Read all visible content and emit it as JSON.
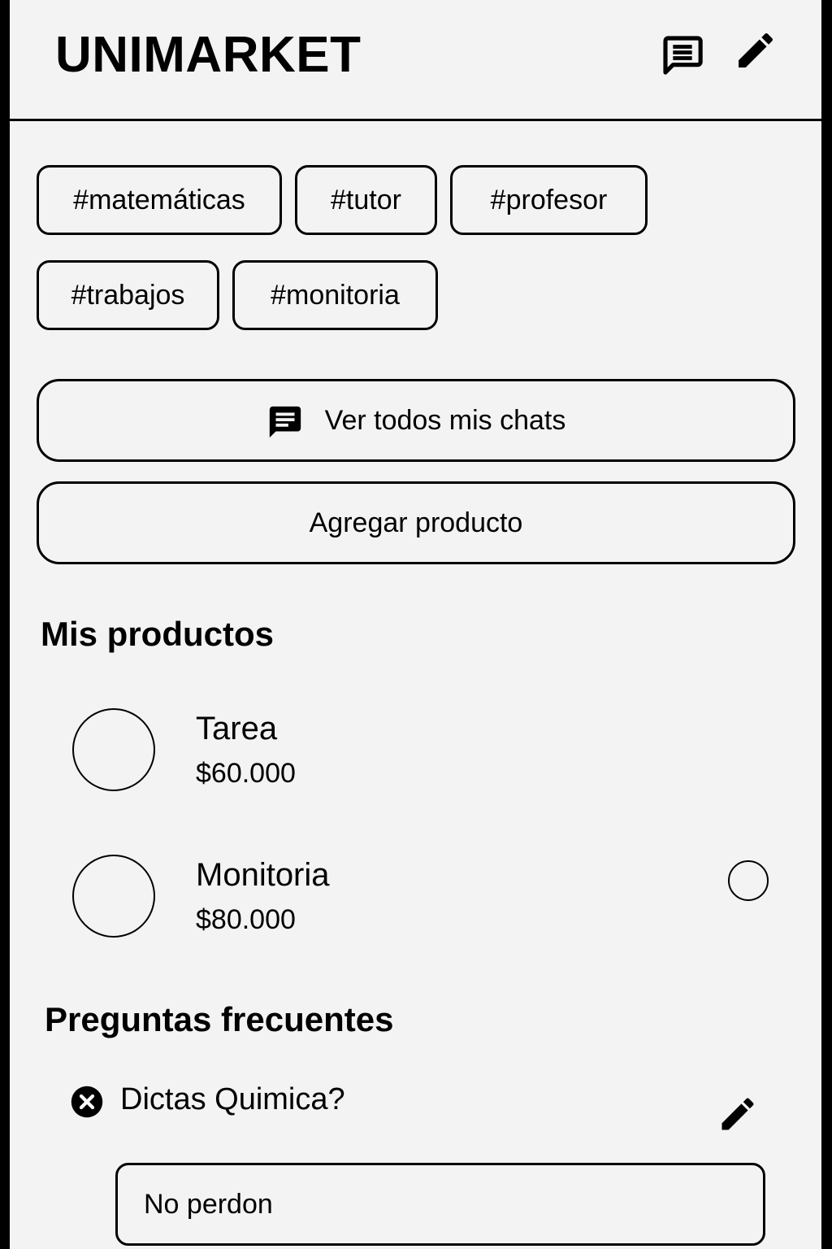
{
  "header": {
    "title": "UNIMARKET",
    "icons": [
      "chat-icon",
      "edit-icon"
    ]
  },
  "tags": [
    "#matemáticas",
    "#tutor",
    "#profesor",
    "#trabajos",
    "#monitoria"
  ],
  "buttons": {
    "view_chats": "Ver todos mis chats",
    "view_chats_icon": "chat-icon",
    "add_product": "Agregar producto"
  },
  "products": {
    "title": "Mis productos",
    "items": [
      {
        "name": "Tarea",
        "price": "$60.000"
      },
      {
        "name": "Monitoria",
        "price": "$80.000"
      }
    ]
  },
  "faq": {
    "title": "Preguntas frecuentes",
    "items": [
      {
        "question": "Dictas Quimica?",
        "answer": "No perdon"
      }
    ]
  },
  "colors": {
    "background": "#f3f3f3",
    "foreground": "#000000"
  }
}
